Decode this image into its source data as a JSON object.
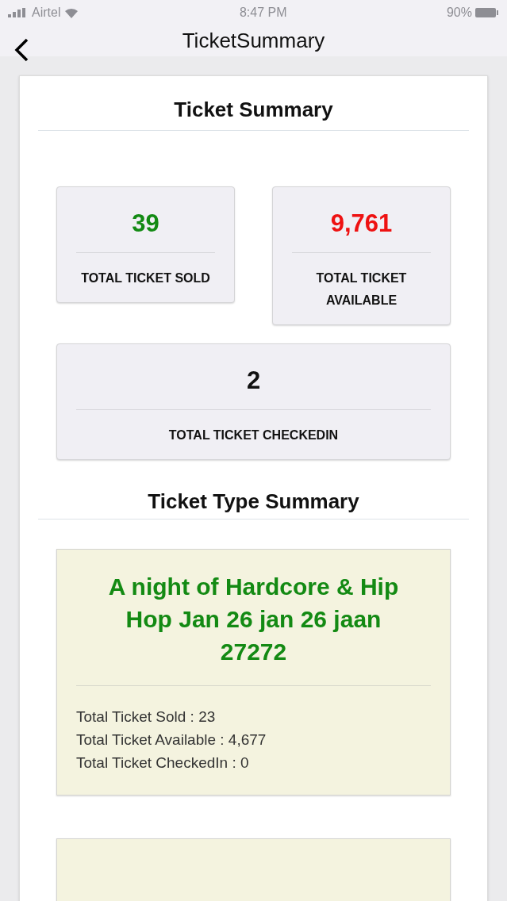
{
  "status_bar": {
    "carrier": "Airtel",
    "time": "8:47 PM",
    "battery": "90%"
  },
  "nav": {
    "title": "TicketSummary"
  },
  "summary": {
    "title": "Ticket Summary",
    "stats": [
      {
        "value": "39",
        "label": "TOTAL TICKET SOLD",
        "color": "#138a13"
      },
      {
        "value": "9,761",
        "label": "TOTAL TICKET AVAILABLE",
        "color": "#ee1111"
      },
      {
        "value": "2",
        "label": "TOTAL TICKET CHECKEDIN",
        "color": "#111111"
      }
    ]
  },
  "type_summary": {
    "title": "Ticket Type Summary",
    "types": [
      {
        "name": "A night of Hardcore & Hip Hop Jan 26 jan 26 jaan 27272",
        "lines": [
          "Total Ticket Sold : 23",
          "Total Ticket Available : 4,677",
          "Total Ticket CheckedIn : 0"
        ]
      },
      {
        "kind": "partial"
      }
    ]
  }
}
